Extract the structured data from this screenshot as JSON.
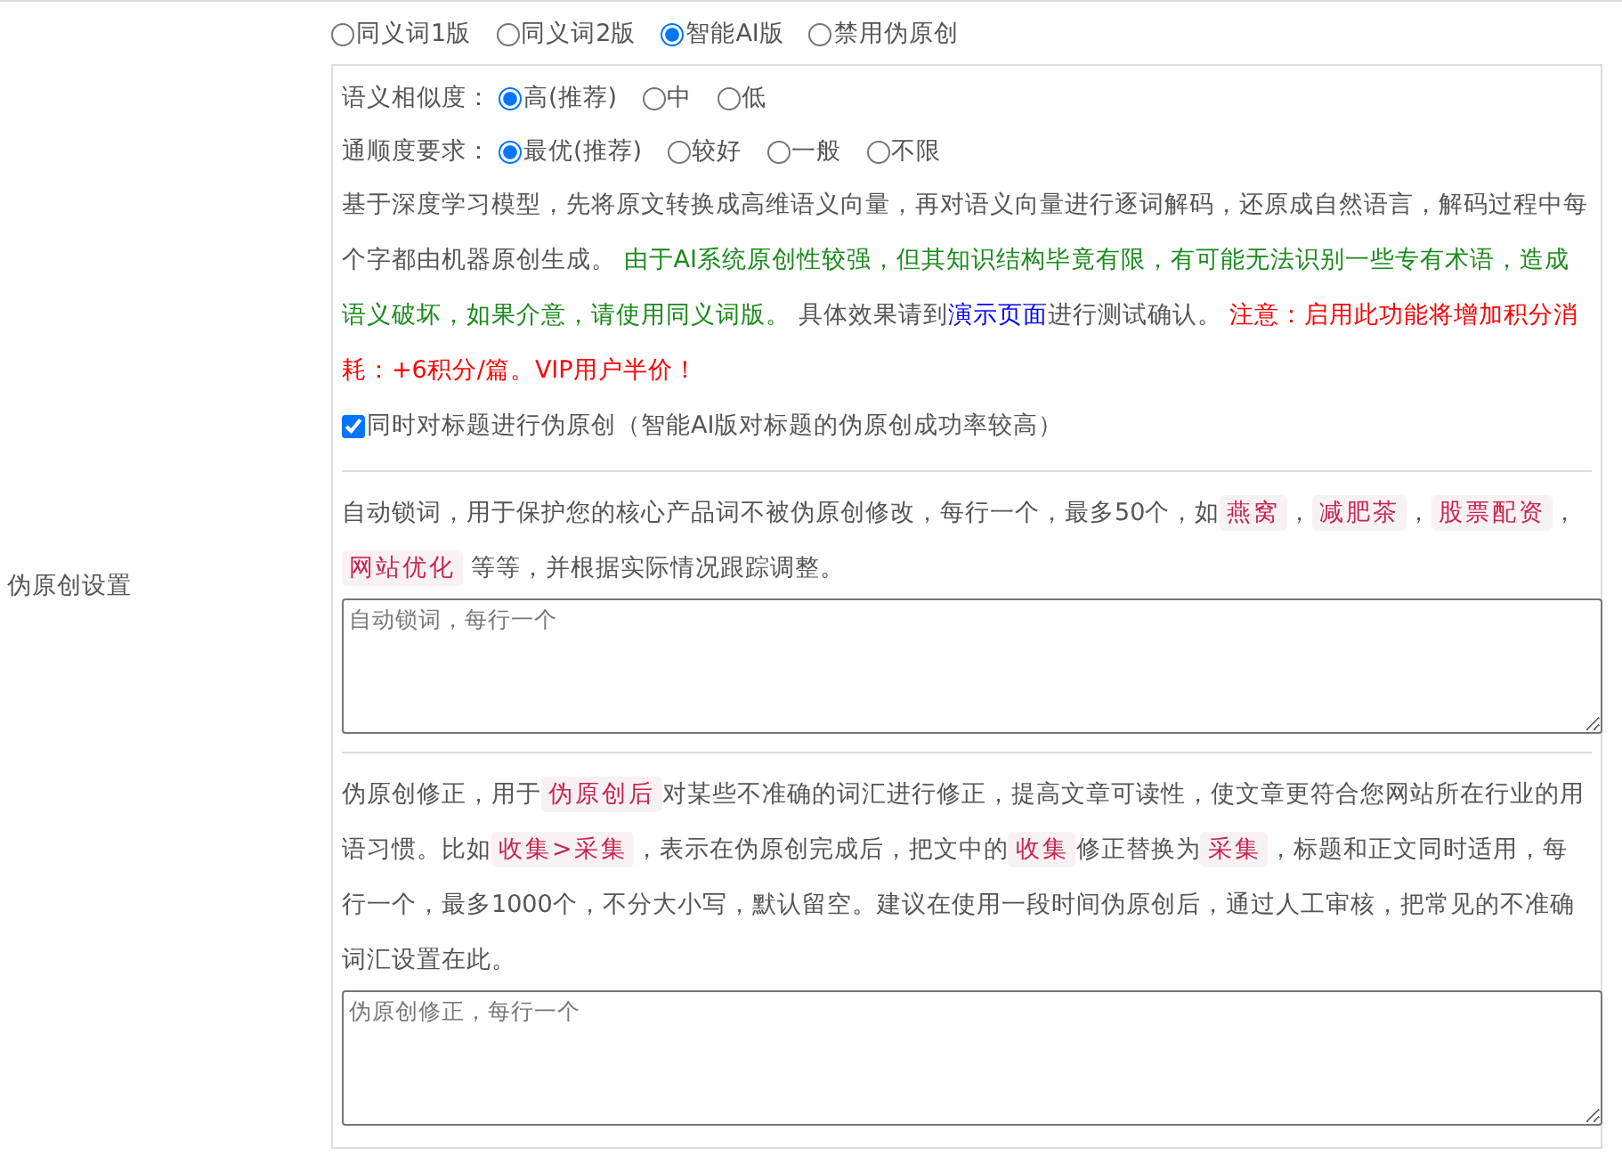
{
  "sidebar_label": "伪原创设置",
  "modes": [
    {
      "label": "同义词1版",
      "selected": false
    },
    {
      "label": "同义词2版",
      "selected": false
    },
    {
      "label": "智能AI版",
      "selected": true
    },
    {
      "label": "禁用伪原创",
      "selected": false
    }
  ],
  "similarity": {
    "label": "语义相似度：",
    "options": [
      {
        "label": "高(推荐)",
        "selected": true
      },
      {
        "label": "中",
        "selected": false
      },
      {
        "label": "低",
        "selected": false
      }
    ]
  },
  "fluency": {
    "label": "通顺度要求：",
    "options": [
      {
        "label": "最优(推荐)",
        "selected": true
      },
      {
        "label": "较好",
        "selected": false
      },
      {
        "label": "一般",
        "selected": false
      },
      {
        "label": "不限",
        "selected": false
      }
    ]
  },
  "description": [
    {
      "kind": "plain",
      "text": "基于深度学习模型，先将原文转换成高维语义向量，再对语义向量进行逐词解码，还原成自然语言，解码过程中每个字都由机器原创生成。 "
    },
    {
      "kind": "note",
      "text": "由于AI系统原创性较强，但其知识结构毕竟有限，有可能无法识别一些专有术语，造成语义破坏，如果介意，请使用同义词版。"
    },
    {
      "kind": "plain",
      "text": " 具体效果请到"
    },
    {
      "kind": "link",
      "text": "演示页面"
    },
    {
      "kind": "plain",
      "text": "进行测试确认。 "
    },
    {
      "kind": "warning",
      "text": "注意：启用此功能将增加积分消耗：+6积分/篇。VIP用户半价！"
    }
  ],
  "title_checkbox": {
    "label": "同时对标题进行伪原创（智能AI版对标题的伪原创成功率较高）",
    "checked": true
  },
  "lock_words": {
    "description": [
      {
        "kind": "plain",
        "text": "自动锁词，用于保护您的核心产品词不被伪原创修改，每行一个，最多50个，如"
      },
      {
        "kind": "code",
        "text": "燕窝"
      },
      {
        "kind": "plain",
        "text": "，"
      },
      {
        "kind": "code",
        "text": "减肥茶"
      },
      {
        "kind": "plain",
        "text": "，"
      },
      {
        "kind": "code",
        "text": "股票配资"
      },
      {
        "kind": "plain",
        "text": "，"
      },
      {
        "kind": "code",
        "text": "网站优化"
      },
      {
        "kind": "plain",
        "text": " 等等，并根据实际情况跟踪调整。"
      }
    ],
    "placeholder": "自动锁词，每行一个"
  },
  "corrections": {
    "description": [
      {
        "kind": "plain",
        "text": "伪原创修正，用于"
      },
      {
        "kind": "code",
        "text": "伪原创后"
      },
      {
        "kind": "plain",
        "text": "对某些不准确的词汇进行修正，提高文章可读性，使文章更符合您网站所在行业的用语习惯。比如"
      },
      {
        "kind": "code",
        "text": "收集>采集"
      },
      {
        "kind": "plain",
        "text": "，表示在伪原创完成后，把文中的"
      },
      {
        "kind": "code",
        "text": "收集"
      },
      {
        "kind": "plain",
        "text": "修正替换为"
      },
      {
        "kind": "code",
        "text": "采集"
      },
      {
        "kind": "plain",
        "text": "，标题和正文同时适用，每行一个，最多1000个，不分大小写，默认留空。建议在使用一段时间伪原创后，通过人工审核，把常见的不准确词汇设置在此。"
      }
    ],
    "placeholder": "伪原创修正，每行一个"
  }
}
